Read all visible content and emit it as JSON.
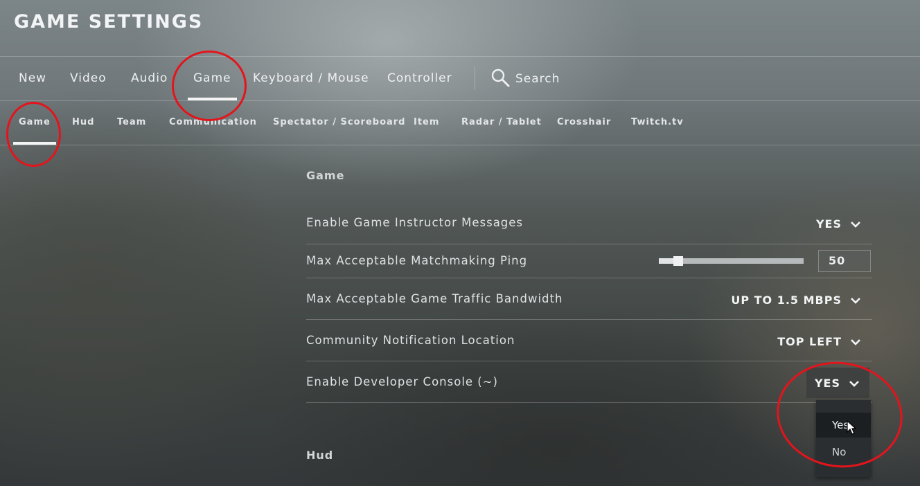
{
  "header": {
    "title": "GAME SETTINGS"
  },
  "main_tabs": [
    {
      "label": "New",
      "active": false
    },
    {
      "label": "Video",
      "active": false
    },
    {
      "label": "Audio",
      "active": false
    },
    {
      "label": "Game",
      "active": true
    },
    {
      "label": "Keyboard / Mouse",
      "active": false
    },
    {
      "label": "Controller",
      "active": false
    }
  ],
  "search": {
    "label": "Search",
    "icon": "magnifier-icon"
  },
  "sub_tabs": [
    {
      "label": "Game",
      "active": true
    },
    {
      "label": "Hud",
      "active": false
    },
    {
      "label": "Team",
      "active": false
    },
    {
      "label": "Communication",
      "active": false
    },
    {
      "label": "Spectator / Scoreboard",
      "active": false
    },
    {
      "label": "Item",
      "active": false
    },
    {
      "label": "Radar / Tablet",
      "active": false
    },
    {
      "label": "Crosshair",
      "active": false
    },
    {
      "label": "Twitch.tv",
      "active": false
    }
  ],
  "sections": {
    "game_heading": "Game",
    "hud_heading": "Hud"
  },
  "settings": [
    {
      "label": "Enable Game Instructor Messages",
      "value": "YES"
    },
    {
      "label": "Max Acceptable Matchmaking Ping",
      "value": "50",
      "slider_fraction": 0.1
    },
    {
      "label": "Max Acceptable Game Traffic Bandwidth",
      "value": "UP TO 1.5 MBPS"
    },
    {
      "label": "Community Notification Location",
      "value": "TOP LEFT"
    },
    {
      "label": "Enable Developer Console (~)",
      "value": "YES",
      "open": true
    }
  ],
  "dropdown_menu": {
    "options": [
      {
        "label": "Yes",
        "hovered": true
      },
      {
        "label": "No",
        "hovered": false
      }
    ]
  },
  "colors": {
    "annotation": "#e4141c",
    "active_underline": "#f4f4f4",
    "menu_background": "#2b2e30"
  }
}
